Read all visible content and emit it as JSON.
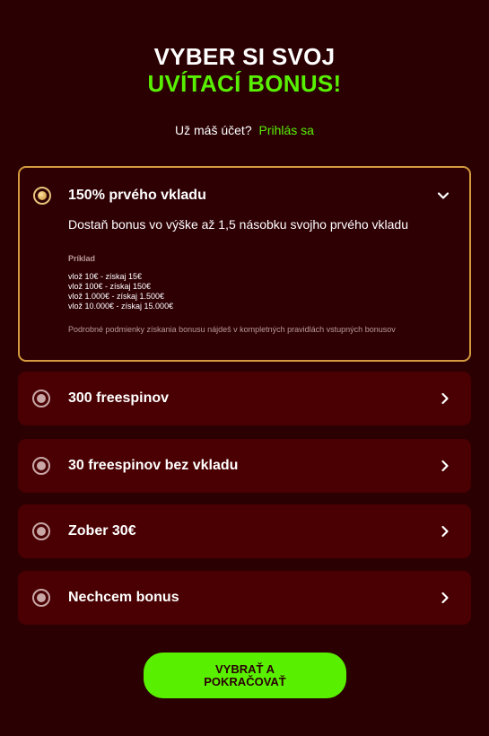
{
  "header": {
    "title_line1": "VYBER SI SVOJ",
    "title_line2": "UVÍTACÍ BONUS!"
  },
  "login": {
    "question": "Už máš účet?",
    "link": "Prihlás sa"
  },
  "options": [
    {
      "label": "150% prvého vkladu",
      "expanded": true,
      "description": "Dostaň bonus vo výške až 1,5 násobku svojho prvého vkladu",
      "example_label": "Príklad",
      "examples": [
        "vlož 10€ - získaj 15€",
        "vlož 100€ - získaj 150€",
        "vlož 1.000€ - získaj 1.500€",
        "vlož 10.000€ - získaj 15.000€"
      ],
      "note": "Podrobné podmienky získania bonusu nájdeš v kompletných pravidlách vstupných bonusov"
    },
    {
      "label": "300 freespinov"
    },
    {
      "label": "30 freespinov bez vkladu"
    },
    {
      "label": "Zober 30€"
    },
    {
      "label": "Nechcem bonus"
    }
  ],
  "cta": {
    "label": "VYBRAŤ A POKRAČOVAŤ"
  },
  "colors": {
    "background": "#2a0003",
    "card": "#4a0002",
    "accent_green": "#58f000",
    "selected_border": "#d49a3f"
  },
  "icons": {
    "radio": "radio-icon",
    "chevron_down": "chevron-down-icon",
    "chevron_right": "chevron-right-icon"
  }
}
